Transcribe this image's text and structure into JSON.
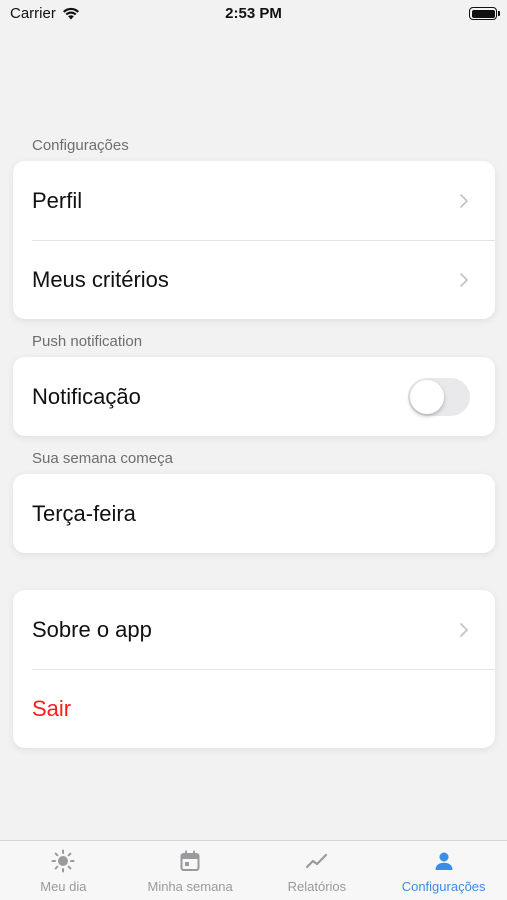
{
  "status_bar": {
    "carrier": "Carrier",
    "time": "2:53 PM"
  },
  "sections": {
    "configuracoes": {
      "header": "Configurações",
      "items": [
        {
          "label": "Perfil"
        },
        {
          "label": "Meus critérios"
        }
      ]
    },
    "push": {
      "header": "Push notification",
      "item": {
        "label": "Notificação",
        "toggle_on": false
      }
    },
    "semana": {
      "header": "Sua semana começa",
      "item": {
        "label": "Terça-feira"
      }
    },
    "misc": {
      "items": [
        {
          "label": "Sobre o app"
        },
        {
          "label": "Sair"
        }
      ]
    }
  },
  "tab_bar": {
    "items": [
      {
        "label": "Meu dia",
        "icon": "sun-icon"
      },
      {
        "label": "Minha semana",
        "icon": "calendar-icon"
      },
      {
        "label": "Relatórios",
        "icon": "chart-line-icon"
      },
      {
        "label": "Configurações",
        "icon": "person-icon",
        "active": true
      }
    ]
  },
  "colors": {
    "accent": "#3a8ee6",
    "danger": "#ff1a1a",
    "inactive": "#9a9a9e"
  }
}
